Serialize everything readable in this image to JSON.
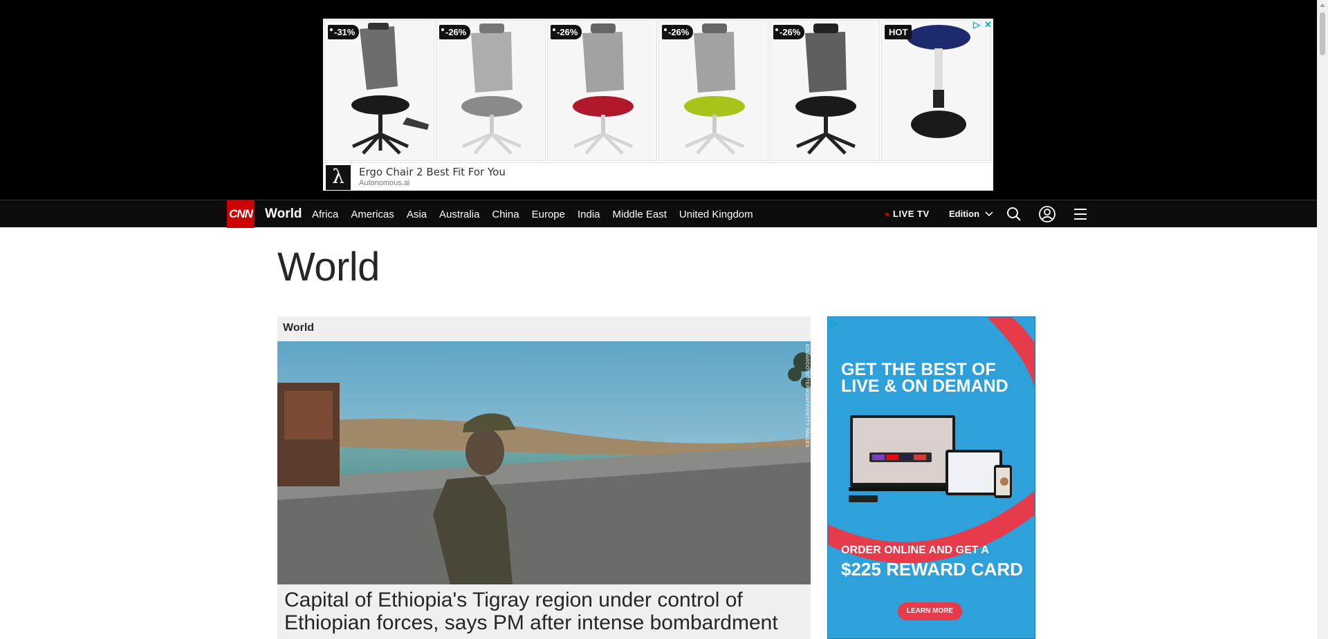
{
  "top_ad": {
    "badges": [
      "-31%",
      "-26%",
      "-26%",
      "-26%",
      "-26%",
      "HOT"
    ],
    "seat_colors": [
      "#1a1a1a",
      "#8a8a8a",
      "#b0182a",
      "#a8c41a",
      "#1a1a1a",
      "#1e2a6e"
    ],
    "logo_glyph": "λ",
    "title": "Ergo Chair 2 Best Fit For You",
    "domain": "Autonomous.ai",
    "adchoices_icon": "▷",
    "close_icon": "✕"
  },
  "nav": {
    "logo": "CNN",
    "section": "World",
    "links": [
      "Africa",
      "Americas",
      "Asia",
      "Australia",
      "China",
      "Europe",
      "India",
      "Middle East",
      "United Kingdom"
    ],
    "live_tv": "LIVE TV",
    "edition": "Edition",
    "icons": [
      "search-icon",
      "account-icon",
      "menu-icon"
    ]
  },
  "page": {
    "title": "World"
  },
  "lead_story": {
    "label": "World",
    "photo_credit": "EDUARDO SOTERAS/AFP/GETTY IMAGES",
    "headline": "Capital of Ethiopia's Tigray region under control of Ethiopian forces, says PM after intense bombardment"
  },
  "side_ad": {
    "headline": "GET THE BEST OF LIVE & ON DEMAND",
    "offer": "ORDER ONLINE AND GET A",
    "amount": "$225 REWARD CARD",
    "button": "LEARN MORE",
    "adchoices_icon": "▷"
  },
  "colors": {
    "cnn_red": "#cc0000",
    "nav_bg": "#0c0c0c",
    "side_ad_bg": "#2ea0da"
  }
}
